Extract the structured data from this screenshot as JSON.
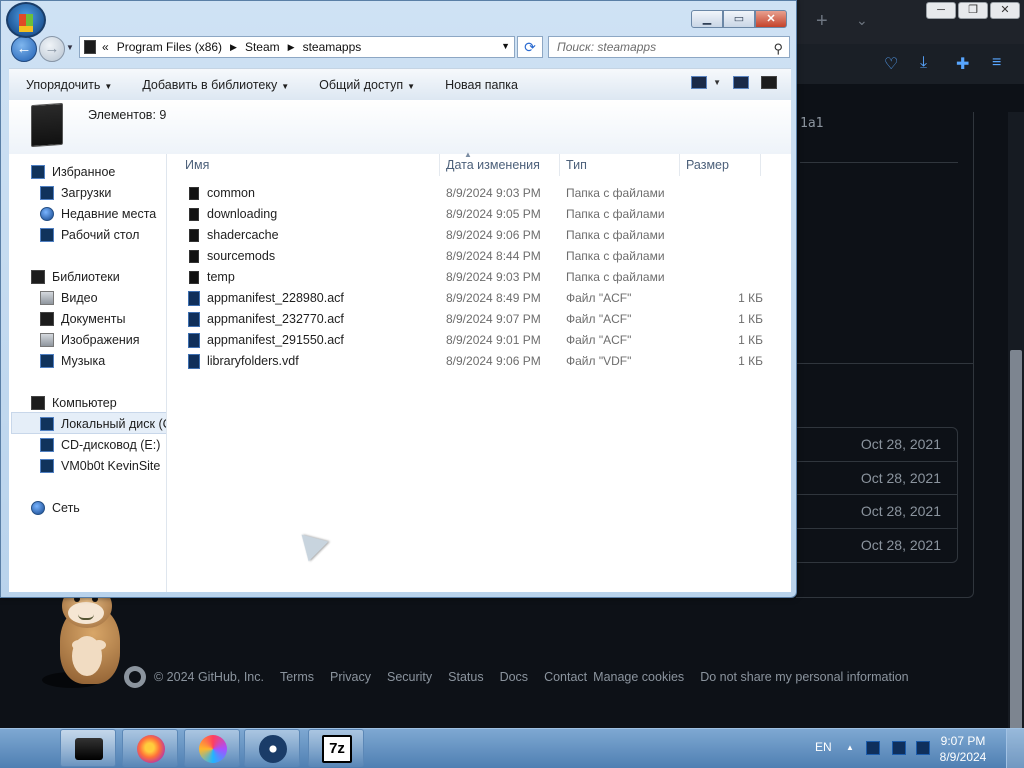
{
  "background_browser": {
    "code_snippet": "1a1",
    "date_rows": [
      "Oct 28, 2021",
      "Oct 28, 2021",
      "Oct 28, 2021",
      "Oct 28, 2021"
    ],
    "footer": {
      "copyright": "© 2024 GitHub, Inc.",
      "links": [
        "Terms",
        "Privacy",
        "Security",
        "Status",
        "Docs",
        "Contact",
        "Manage cookies",
        "Do not share my personal information"
      ]
    }
  },
  "explorer": {
    "address": {
      "overflow": "«",
      "segments": [
        "Program Files (x86)",
        "Steam",
        "steamapps"
      ]
    },
    "search_placeholder": "Поиск: steamapps",
    "toolbar": {
      "organize": "Упорядочить",
      "add_to_library": "Добавить в библиотеку",
      "share": "Общий доступ",
      "new_folder": "Новая папка"
    },
    "details": {
      "items_count": "Элементов: 9"
    },
    "nav": {
      "favorites": "Избранное",
      "downloads": "Загрузки",
      "recent": "Недавние места",
      "desktop": "Рабочий стол",
      "libraries": "Библиотеки",
      "video": "Видео",
      "documents": "Документы",
      "images": "Изображения",
      "music": "Музыка",
      "computer": "Компьютер",
      "local_disk": "Локальный диск (C",
      "cd_drive": "CD-дисковод (E:)",
      "network_share": "VM0b0t KevinSite",
      "network": "Сеть"
    },
    "columns": {
      "name": "Имя",
      "modified": "Дата изменения",
      "type": "Тип",
      "size": "Размер"
    },
    "files": [
      {
        "name": "common",
        "modified": "8/9/2024 9:03 PM",
        "type": "Папка с файлами",
        "size": "",
        "kind": "folder"
      },
      {
        "name": "downloading",
        "modified": "8/9/2024 9:05 PM",
        "type": "Папка с файлами",
        "size": "",
        "kind": "folder"
      },
      {
        "name": "shadercache",
        "modified": "8/9/2024 9:06 PM",
        "type": "Папка с файлами",
        "size": "",
        "kind": "folder"
      },
      {
        "name": "sourcemods",
        "modified": "8/9/2024 8:44 PM",
        "type": "Папка с файлами",
        "size": "",
        "kind": "folder"
      },
      {
        "name": "temp",
        "modified": "8/9/2024 9:03 PM",
        "type": "Папка с файлами",
        "size": "",
        "kind": "folder"
      },
      {
        "name": "appmanifest_228980.acf",
        "modified": "8/9/2024 8:49 PM",
        "type": "Файл \"ACF\"",
        "size": "1 КБ",
        "kind": "file"
      },
      {
        "name": "appmanifest_232770.acf",
        "modified": "8/9/2024 9:07 PM",
        "type": "Файл \"ACF\"",
        "size": "1 КБ",
        "kind": "file"
      },
      {
        "name": "appmanifest_291550.acf",
        "modified": "8/9/2024 9:01 PM",
        "type": "Файл \"ACF\"",
        "size": "1 КБ",
        "kind": "file"
      },
      {
        "name": "libraryfolders.vdf",
        "modified": "8/9/2024 9:06 PM",
        "type": "Файл \"VDF\"",
        "size": "1 КБ",
        "kind": "file"
      }
    ]
  },
  "taskbar": {
    "seven_zip_label": "7z",
    "language": "EN",
    "time": "9:07 PM",
    "date": "8/9/2024"
  }
}
